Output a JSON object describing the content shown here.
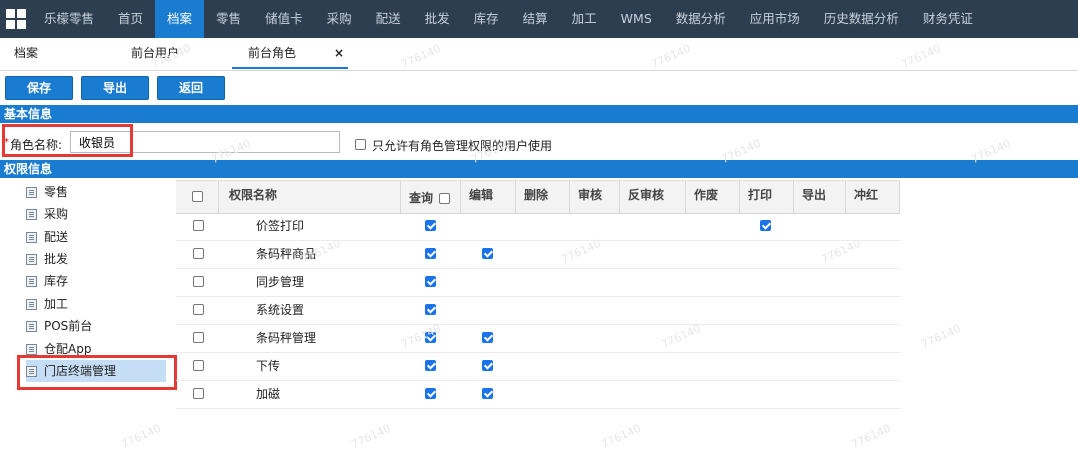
{
  "nav": {
    "items": [
      "乐檬零售",
      "首页",
      "档案",
      "零售",
      "储值卡",
      "采购",
      "配送",
      "批发",
      "库存",
      "结算",
      "加工",
      "WMS",
      "数据分析",
      "应用市场",
      "历史数据分析",
      "财务凭证"
    ],
    "active_index": 2
  },
  "tabs": [
    {
      "label": "档案"
    },
    {
      "label": "前台用户"
    },
    {
      "label": "前台角色",
      "active": true,
      "close": "×"
    }
  ],
  "toolbar": {
    "save": "保存",
    "export": "导出",
    "back": "返回"
  },
  "basic_info": {
    "title": "基本信息",
    "required_mark": "*",
    "role_label": "角色名称:",
    "role_value": "收银员",
    "only_label": "只允许有角色管理权限的用户使用"
  },
  "perm_info": {
    "title": "权限信息"
  },
  "tree": {
    "items": [
      "零售",
      "采购",
      "配送",
      "批发",
      "库存",
      "加工",
      "POS前台",
      "仓配App",
      "门店终端管理"
    ],
    "selected_index": 8
  },
  "grid": {
    "columns": [
      "权限名称",
      "查询",
      "编辑",
      "删除",
      "审核",
      "反审核",
      "作废",
      "打印",
      "导出",
      "冲红"
    ],
    "rows": [
      {
        "name": "价签打印",
        "query": true,
        "edit": false,
        "print": true
      },
      {
        "name": "条码秤商品",
        "query": true,
        "edit": true,
        "print": false
      },
      {
        "name": "同步管理",
        "query": true,
        "edit": false,
        "print": false
      },
      {
        "name": "系统设置",
        "query": true,
        "edit": false,
        "print": false
      },
      {
        "name": "条码秤管理",
        "query": true,
        "edit": true,
        "print": false
      },
      {
        "name": "下传",
        "query": true,
        "edit": true,
        "print": false
      },
      {
        "name": "加磁",
        "query": true,
        "edit": true,
        "print": false
      }
    ]
  },
  "watermark": "776140",
  "colors": {
    "nav_bg": "#2d3e50",
    "accent": "#1a7cd0",
    "highlight_red": "#e53935",
    "selected_bg": "#c5def5"
  }
}
